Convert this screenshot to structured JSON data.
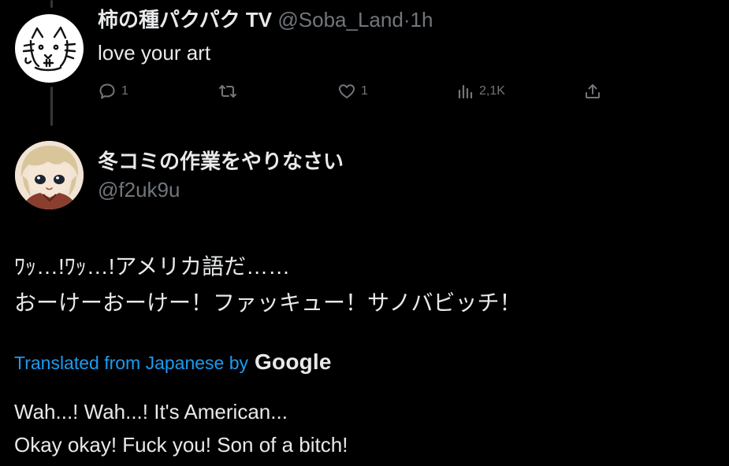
{
  "reply": {
    "display_name": "柿の種パクパク TV",
    "handle": "@Soba_Land",
    "separator": "·",
    "time": "1h",
    "text": "love your art",
    "actions": {
      "reply_count": "1",
      "retweet_count": "",
      "like_count": "1",
      "views_count": "2,1K"
    },
    "avatar_icon": "cat-doodle-avatar"
  },
  "main_tweet": {
    "display_name": "冬コミの作業をやりなさい",
    "handle": "@f2uk9u",
    "avatar_icon": "anime-character-avatar",
    "original_lines": [
      "ﾜｯ…!ﾜｯ…!アメリカ語だ……",
      "おーけーおーけー！ファッキュー！サノバビッチ！"
    ],
    "translation": {
      "label": "Translated from Japanese by",
      "provider": "Google",
      "lines": [
        "Wah...! Wah...! It's American...",
        "Okay okay! Fuck you! Son of a bitch!"
      ]
    }
  },
  "colors": {
    "background": "#000000",
    "primary_text": "#e7e9ea",
    "secondary_text": "#71767b",
    "link": "#1d9bf0",
    "thread_line": "#333639"
  }
}
